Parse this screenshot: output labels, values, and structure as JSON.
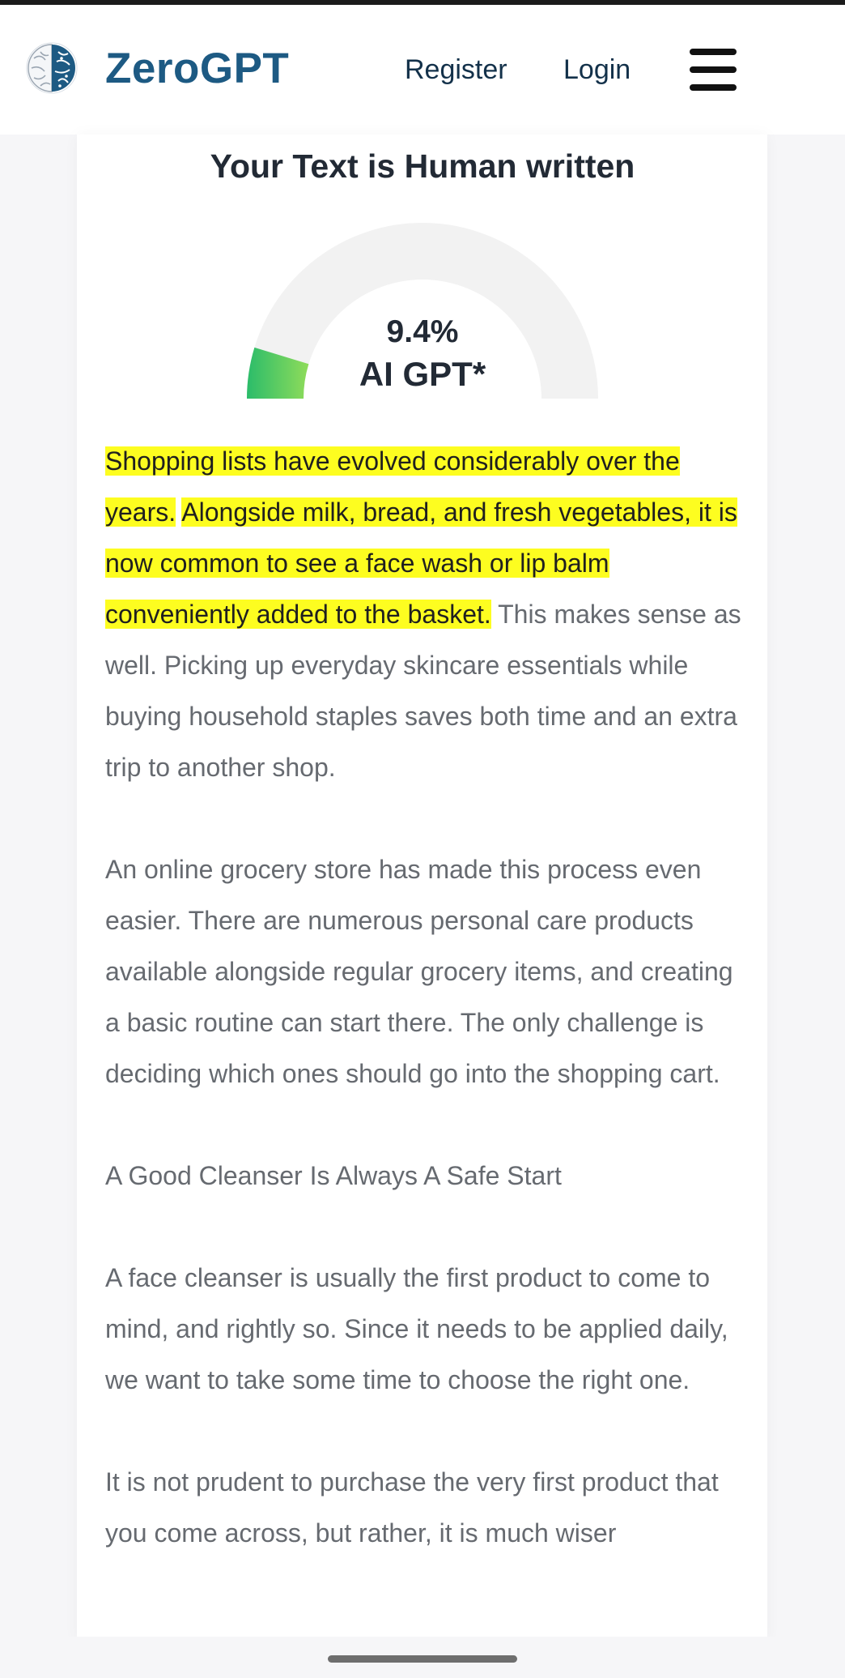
{
  "header": {
    "logo_text": "ZeroGPT",
    "logo_icon": "brain-icon",
    "register_label": "Register",
    "login_label": "Login",
    "menu_icon": "hamburger-menu-icon"
  },
  "result": {
    "title": "Your Text is Human written",
    "percentage_text": "9.4%",
    "percentage_value": 9.4,
    "label": "AI GPT*"
  },
  "colors": {
    "brand": "#1d5a83",
    "highlight": "#fdfd20",
    "gauge_track": "#f2f2f2",
    "gauge_fill_start": "#2bbc6a",
    "gauge_fill_end": "#8fdc5a"
  },
  "content": {
    "p1_hl1": "Shopping lists have evolved considerably over the years.",
    "p1_hl2": "Alongside milk, bread, and fresh vegetables, it is now common to see a face wash or lip balm conveniently added to the basket.",
    "p1_rest": "This makes sense as well. Picking up everyday skincare essentials while buying household staples saves both time and an extra trip to another shop.",
    "p2": "An online grocery store has made this process even easier. There are numerous personal care products available alongside regular grocery items, and creating a basic routine can start there. The only challenge is deciding which ones should go into the shopping cart.",
    "heading": "A Good Cleanser Is Always A Safe Start",
    "p3": "A face cleanser is usually the first product to come to mind, and rightly so. Since it needs to be applied daily, we want to take some time to choose the right one.",
    "p4": "It is not prudent to purchase the very first product that you come across, but rather, it is much wiser"
  }
}
